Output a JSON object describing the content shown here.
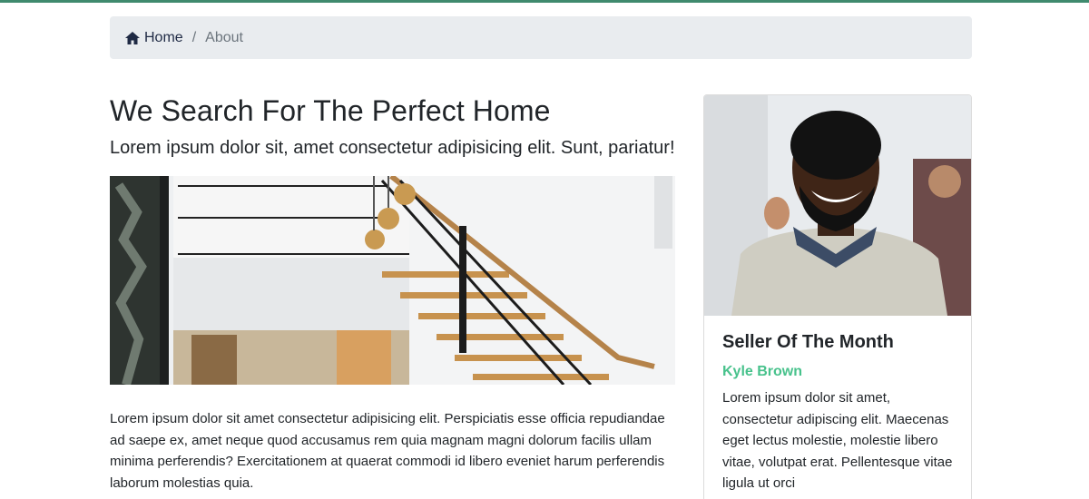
{
  "breadcrumb": {
    "home_label": "Home",
    "separator": "/",
    "current_label": "About"
  },
  "main": {
    "title": "We Search For The Perfect Home",
    "lead": "Lorem ipsum dolor sit, amet consectetur adipisicing elit. Sunt, pariatur!",
    "body": "Lorem ipsum dolor sit amet consectetur adipisicing elit. Perspiciatis esse officia repudiandae ad saepe ex, amet neque quod accusamus rem quia magnam magni dolorum facilis ullam minima perferendis? Exercitationem at quaerat commodi id libero eveniet harum perferendis laborum molestias quia."
  },
  "seller_card": {
    "title": "Seller Of The Month",
    "name": "Kyle Brown",
    "text": "Lorem ipsum dolor sit amet, consectetur adipiscing elit. Maecenas eget lectus molestie, molestie libero vitae, volutpat erat. Pellentesque vitae ligula ut orci"
  },
  "colors": {
    "accent_top": "#3f8a6e",
    "seller_name": "#48c28c",
    "breadcrumb_bg": "#e9ecef"
  },
  "icons": {
    "home": "home-icon"
  }
}
